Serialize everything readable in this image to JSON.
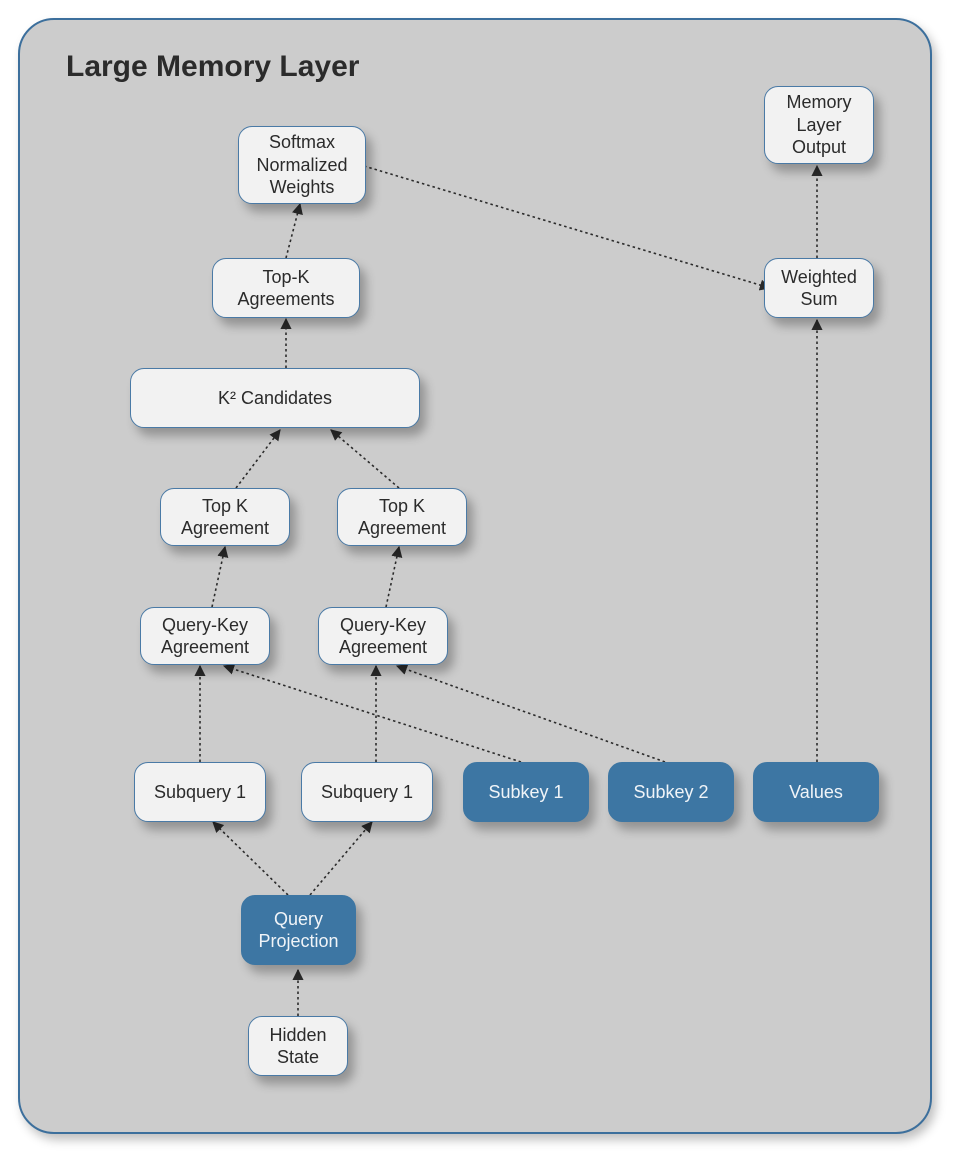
{
  "title": "Large Memory Layer",
  "nodes": {
    "hidden_state": {
      "label": "Hidden\nState"
    },
    "query_projection": {
      "label": "Query\nProjection"
    },
    "subquery_1a": {
      "label": "Subquery 1"
    },
    "subquery_1b": {
      "label": "Subquery 1"
    },
    "subkey_1": {
      "label": "Subkey 1"
    },
    "subkey_2": {
      "label": "Subkey 2"
    },
    "values": {
      "label": "Values"
    },
    "qk_agreement_left": {
      "label": "Query-Key\nAgreement"
    },
    "qk_agreement_right": {
      "label": "Query-Key\nAgreement"
    },
    "topk_agreement_left": {
      "label": "Top K\nAgreement"
    },
    "topk_agreement_right": {
      "label": "Top K\nAgreement"
    },
    "k2_candidates": {
      "label": "K² Candidates"
    },
    "topk_agreements": {
      "label": "Top-K\nAgreements"
    },
    "softmax_weights": {
      "label": "Softmax\nNormalized\nWeights"
    },
    "weighted_sum": {
      "label": "Weighted\nSum"
    },
    "memory_output": {
      "label": "Memory\nLayer\nOutput"
    }
  },
  "edges": [
    {
      "from": "hidden_state",
      "to": "query_projection"
    },
    {
      "from": "query_projection",
      "to": "subquery_1a"
    },
    {
      "from": "query_projection",
      "to": "subquery_1b"
    },
    {
      "from": "subquery_1a",
      "to": "qk_agreement_left"
    },
    {
      "from": "subquery_1b",
      "to": "qk_agreement_right"
    },
    {
      "from": "subkey_1",
      "to": "qk_agreement_left"
    },
    {
      "from": "subkey_2",
      "to": "qk_agreement_right"
    },
    {
      "from": "qk_agreement_left",
      "to": "topk_agreement_left"
    },
    {
      "from": "qk_agreement_right",
      "to": "topk_agreement_right"
    },
    {
      "from": "topk_agreement_left",
      "to": "k2_candidates"
    },
    {
      "from": "topk_agreement_right",
      "to": "k2_candidates"
    },
    {
      "from": "k2_candidates",
      "to": "topk_agreements"
    },
    {
      "from": "topk_agreements",
      "to": "softmax_weights"
    },
    {
      "from": "softmax_weights",
      "to": "weighted_sum"
    },
    {
      "from": "values",
      "to": "weighted_sum"
    },
    {
      "from": "weighted_sum",
      "to": "memory_output"
    }
  ]
}
